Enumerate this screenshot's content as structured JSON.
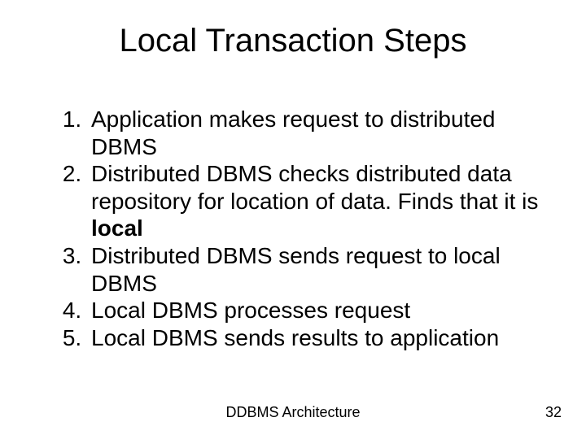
{
  "title": "Local Transaction Steps",
  "steps": {
    "s1": "Application makes request to distributed DBMS",
    "s2a": "Distributed DBMS checks distributed data repository for location of data. Finds that it is ",
    "s2b": "local",
    "s3": "Distributed DBMS sends request to local DBMS",
    "s4": "Local DBMS processes request",
    "s5": "Local DBMS sends results to application"
  },
  "footer": {
    "center": "DDBMS Architecture",
    "page": "32"
  }
}
